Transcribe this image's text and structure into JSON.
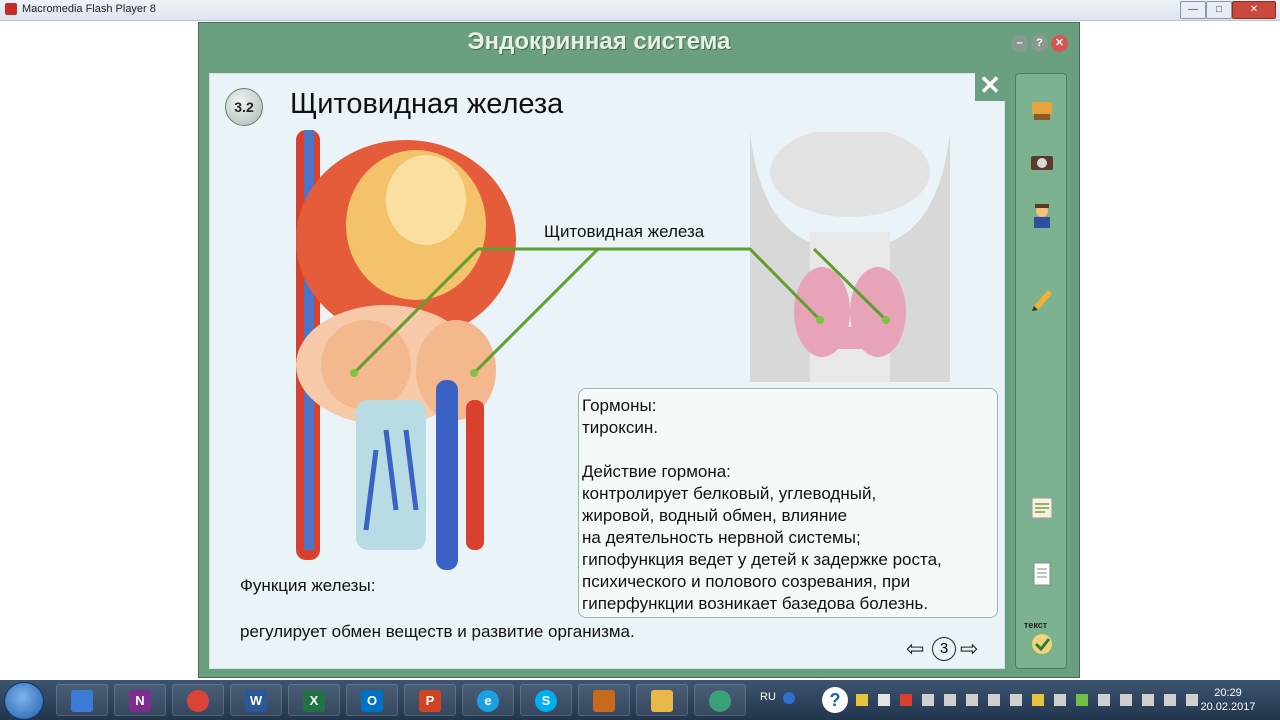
{
  "os_window": {
    "title": "Macromedia Flash Player 8",
    "min_label": "—",
    "max_label": "□",
    "close_label": "✕"
  },
  "app": {
    "title": "Эндокринная система",
    "help_label": "?",
    "close_x": "✕"
  },
  "slide": {
    "number": "3.2",
    "heading": "Щитовидная железа",
    "callout_label": "Щитовидная железа",
    "info_lines": [
      "Гормоны:",
      "тироксин.",
      "",
      "Действие гормона:",
      "контролирует белковый, углеводный,",
      "жировой, водный обмен, влияние",
      "на деятельность нервной системы;",
      "гипофункция ведет у детей к задержке роста,",
      "психического и полового созревания, при",
      "гиперфункции возникает базедова болезнь."
    ],
    "function_label": "Функция железы:",
    "function_text": "регулирует обмен веществ и развитие организма.",
    "page_number": "3",
    "prev_arrow": "⇦",
    "next_arrow": "⇨"
  },
  "sidebar": {
    "icons": [
      "classroom-icon",
      "camera-icon",
      "teacher-icon",
      "pencil-icon",
      "notes-icon",
      "document-icon",
      "text-check-icon"
    ],
    "text_button_label": "текст"
  },
  "taskbar": {
    "apps": [
      {
        "name": "speaker",
        "label": "",
        "color": "#3a7bd5"
      },
      {
        "name": "onenote",
        "label": "N",
        "color": "#7b2e8e"
      },
      {
        "name": "chrome",
        "label": "",
        "color": "#db4437"
      },
      {
        "name": "word",
        "label": "W",
        "color": "#2b579a"
      },
      {
        "name": "excel",
        "label": "X",
        "color": "#217346"
      },
      {
        "name": "outlook",
        "label": "O",
        "color": "#0072c6"
      },
      {
        "name": "powerpoint",
        "label": "P",
        "color": "#d04423"
      },
      {
        "name": "internet-explorer",
        "label": "e",
        "color": "#1ba1e2"
      },
      {
        "name": "skype",
        "label": "S",
        "color": "#00aff0"
      },
      {
        "name": "game",
        "label": "",
        "color": "#c86a1e"
      },
      {
        "name": "explorer",
        "label": "",
        "color": "#e8b84a"
      },
      {
        "name": "app",
        "label": "",
        "color": "#3aa07a"
      }
    ],
    "language": "RU",
    "time": "20:29",
    "date": "20.02.2017"
  },
  "colors": {
    "app_frame": "#6aa080",
    "content_bg": "#eaf3f7",
    "callout_line": "#5f9e2f"
  }
}
